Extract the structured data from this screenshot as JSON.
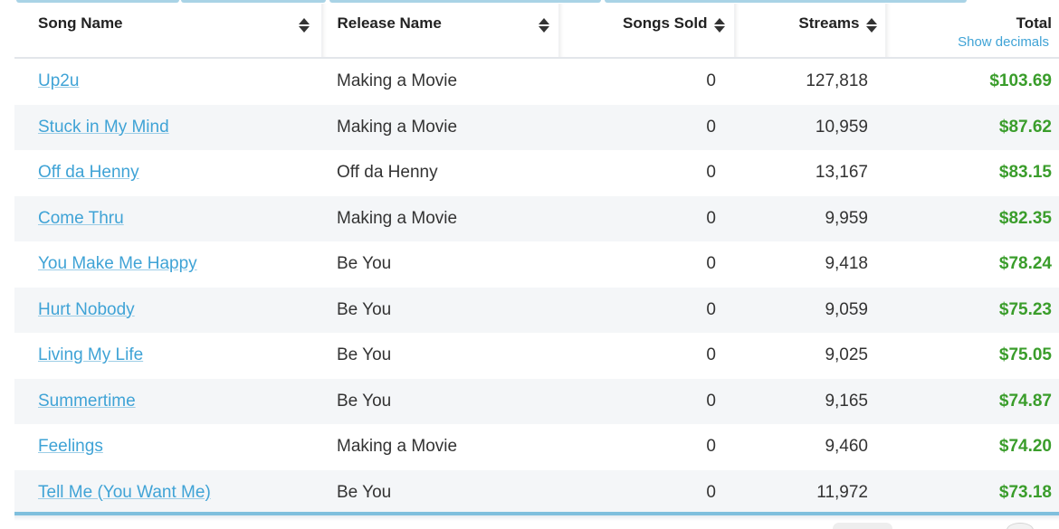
{
  "table": {
    "headers": {
      "song_name": "Song Name",
      "release_name": "Release Name",
      "songs_sold": "Songs Sold",
      "streams": "Streams",
      "total": "Total",
      "show_decimals": "Show decimals"
    },
    "rows": [
      {
        "song": "Up2u",
        "release": "Making a Movie",
        "sold": "0",
        "streams": "127,818",
        "total": "$103.69"
      },
      {
        "song": "Stuck in My Mind",
        "release": "Making a Movie",
        "sold": "0",
        "streams": "10,959",
        "total": "$87.62"
      },
      {
        "song": "Off da Henny",
        "release": "Off da Henny",
        "sold": "0",
        "streams": "13,167",
        "total": "$83.15"
      },
      {
        "song": "Come Thru",
        "release": "Making a Movie",
        "sold": "0",
        "streams": "9,959",
        "total": "$82.35"
      },
      {
        "song": "You Make Me Happy",
        "release": "Be You",
        "sold": "0",
        "streams": "9,418",
        "total": "$78.24"
      },
      {
        "song": "Hurt Nobody",
        "release": "Be You",
        "sold": "0",
        "streams": "9,059",
        "total": "$75.23"
      },
      {
        "song": "Living My Life",
        "release": "Be You",
        "sold": "0",
        "streams": "9,025",
        "total": "$75.05"
      },
      {
        "song": "Summertime",
        "release": "Be You",
        "sold": "0",
        "streams": "9,165",
        "total": "$74.87"
      },
      {
        "song": "Feelings",
        "release": "Making a Movie",
        "sold": "0",
        "streams": "9,460",
        "total": "$74.20"
      },
      {
        "song": "Tell Me (You Want Me)",
        "release": "Be You",
        "sold": "0",
        "streams": "11,972",
        "total": "$73.18"
      }
    ]
  },
  "colors": {
    "link": "#3fa3d6",
    "total_green": "#3a9d2b",
    "accent_bar": "#7fbfdd",
    "row_stripe": "#f4f6f8"
  },
  "icons": {
    "sort": "sort-both-icon"
  }
}
